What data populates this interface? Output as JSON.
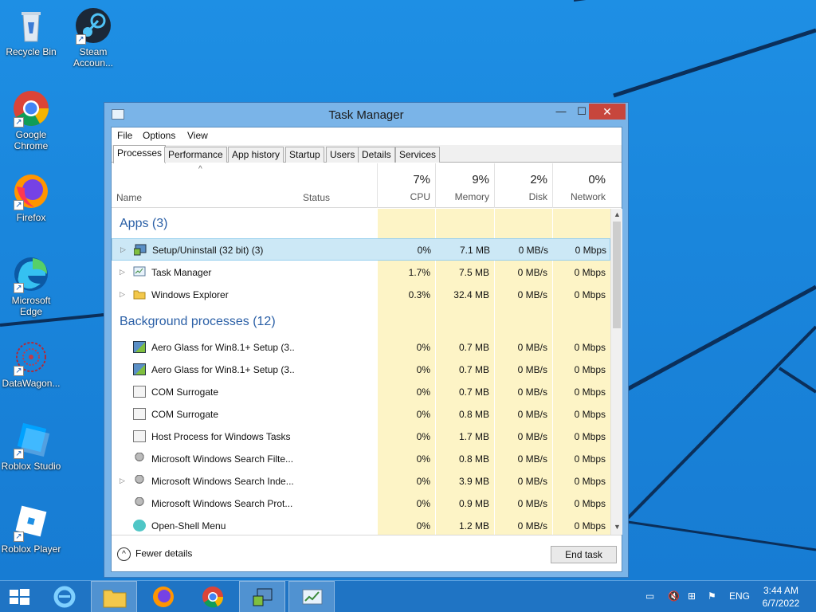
{
  "desktop": {
    "icons": [
      {
        "label": "Recycle Bin"
      },
      {
        "label": "Steam Accoun..."
      },
      {
        "label": "Google Chrome"
      },
      {
        "label": "Firefox"
      },
      {
        "label": "Microsoft Edge"
      },
      {
        "label": "DataWagon..."
      },
      {
        "label": "Roblox Studio"
      },
      {
        "label": "Roblox Player"
      }
    ]
  },
  "window": {
    "title": "Task Manager",
    "min": "—",
    "max": "☐",
    "close": "✕",
    "menu": [
      "File",
      "Options",
      "View"
    ],
    "tabs": [
      "Processes",
      "Performance",
      "App history",
      "Startup",
      "Users",
      "Details",
      "Services"
    ],
    "active_tab": "Processes",
    "columns": {
      "name": "Name",
      "status": "Status",
      "cpu": {
        "pct": "7%",
        "label": "CPU"
      },
      "memory": {
        "pct": "9%",
        "label": "Memory"
      },
      "disk": {
        "pct": "2%",
        "label": "Disk"
      },
      "network": {
        "pct": "0%",
        "label": "Network"
      }
    },
    "groups": {
      "apps": "Apps (3)",
      "background": "Background processes (12)"
    },
    "apps": [
      {
        "name": "Setup/Uninstall (32 bit) (3)",
        "cpu": "0%",
        "mem": "7.1 MB",
        "disk": "0 MB/s",
        "net": "0 Mbps"
      },
      {
        "name": "Task Manager",
        "cpu": "1.7%",
        "mem": "7.5 MB",
        "disk": "0 MB/s",
        "net": "0 Mbps"
      },
      {
        "name": "Windows Explorer",
        "cpu": "0.3%",
        "mem": "32.4 MB",
        "disk": "0 MB/s",
        "net": "0 Mbps"
      }
    ],
    "background": [
      {
        "name": "Aero Glass for Win8.1+ Setup (3...",
        "cpu": "0%",
        "mem": "0.7 MB",
        "disk": "0 MB/s",
        "net": "0 Mbps"
      },
      {
        "name": "Aero Glass for Win8.1+ Setup (3...",
        "cpu": "0%",
        "mem": "0.7 MB",
        "disk": "0 MB/s",
        "net": "0 Mbps"
      },
      {
        "name": "COM Surrogate",
        "cpu": "0%",
        "mem": "0.7 MB",
        "disk": "0 MB/s",
        "net": "0 Mbps"
      },
      {
        "name": "COM Surrogate",
        "cpu": "0%",
        "mem": "0.8 MB",
        "disk": "0 MB/s",
        "net": "0 Mbps"
      },
      {
        "name": "Host Process for Windows Tasks",
        "cpu": "0%",
        "mem": "1.7 MB",
        "disk": "0 MB/s",
        "net": "0 Mbps"
      },
      {
        "name": "Microsoft Windows Search Filte...",
        "cpu": "0%",
        "mem": "0.8 MB",
        "disk": "0 MB/s",
        "net": "0 Mbps"
      },
      {
        "name": "Microsoft Windows Search Inde...",
        "cpu": "0%",
        "mem": "3.9 MB",
        "disk": "0 MB/s",
        "net": "0 Mbps"
      },
      {
        "name": "Microsoft Windows Search Prot...",
        "cpu": "0%",
        "mem": "0.9 MB",
        "disk": "0 MB/s",
        "net": "0 Mbps"
      },
      {
        "name": "Open-Shell Menu",
        "cpu": "0%",
        "mem": "1.2 MB",
        "disk": "0 MB/s",
        "net": "0 Mbps"
      }
    ],
    "footer": {
      "fewer_details": "Fewer details",
      "end_task": "End task"
    }
  },
  "taskbar": {
    "lang": "ENG",
    "time": "3:44 AM",
    "date": "6/7/2022"
  }
}
